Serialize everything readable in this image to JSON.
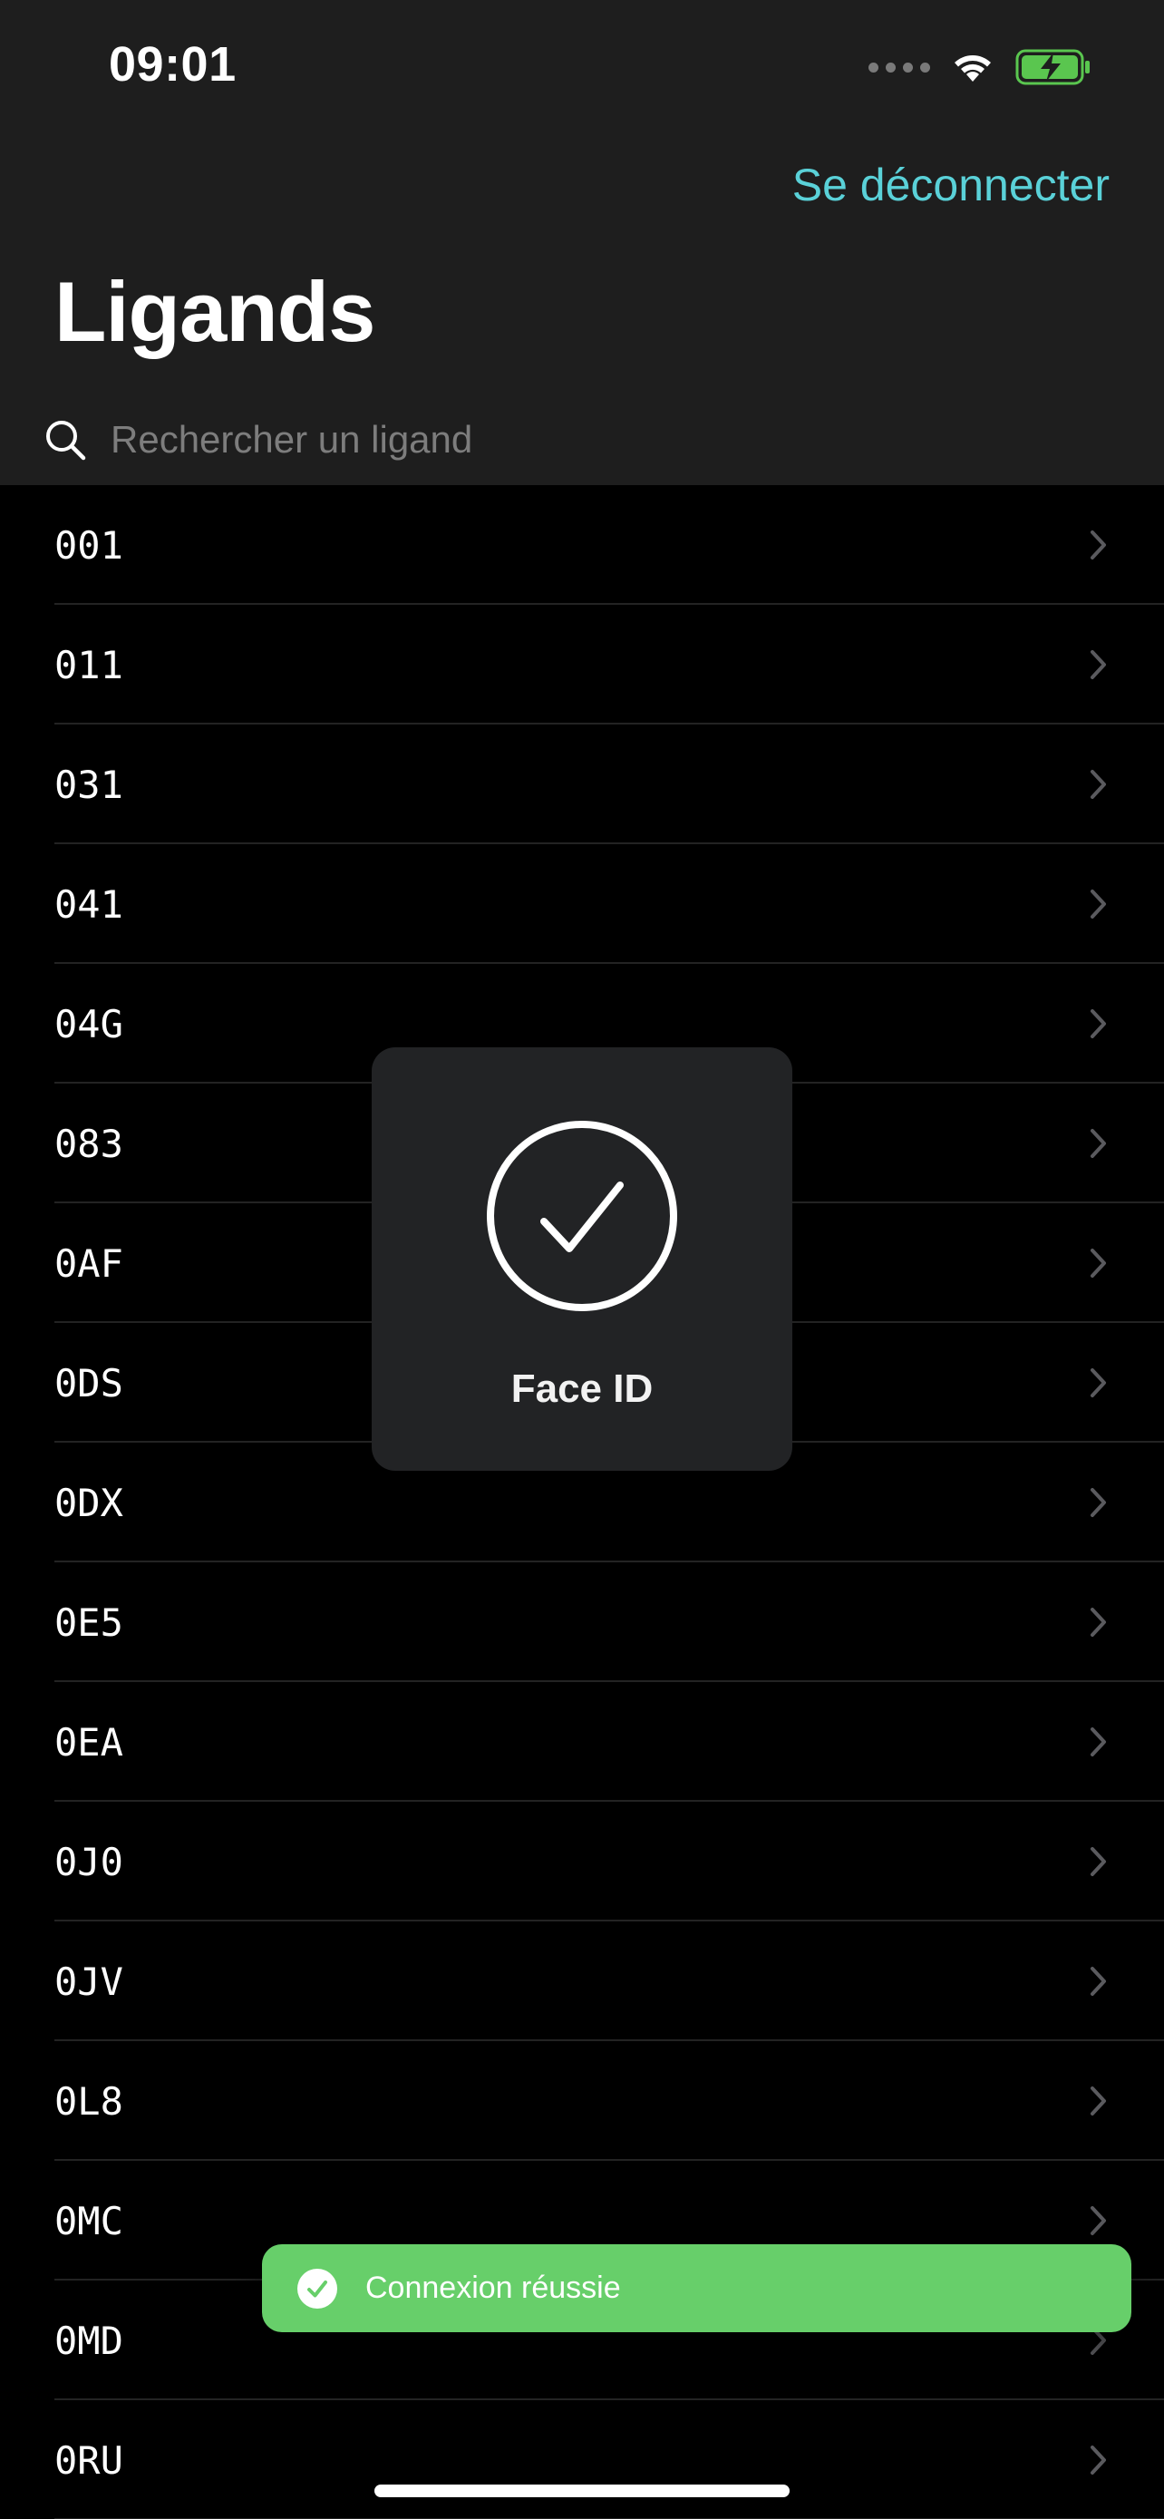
{
  "status_bar": {
    "time": "09:01",
    "icons": [
      "signal-icon",
      "wifi-icon",
      "battery-charging-icon"
    ],
    "battery_color": "#5ac64f"
  },
  "nav": {
    "logout_label": "Se déconnecter",
    "title": "Ligands"
  },
  "search": {
    "placeholder": "Rechercher un ligand",
    "value": ""
  },
  "ligands": [
    "001",
    "011",
    "031",
    "041",
    "04G",
    "083",
    "0AF",
    "0DS",
    "0DX",
    "0E5",
    "0EA",
    "0J0",
    "0JV",
    "0L8",
    "0MC",
    "0MD",
    "0RU"
  ],
  "faceid_hud": {
    "label": "Face ID",
    "icon": "checkmark-circle-icon"
  },
  "toast": {
    "text": "Connexion réussie",
    "icon": "check-circle-icon",
    "color": "#67cf6a"
  },
  "colors": {
    "accent": "#5ad1d8",
    "background": "#000000",
    "header": "#1e1e1e"
  }
}
